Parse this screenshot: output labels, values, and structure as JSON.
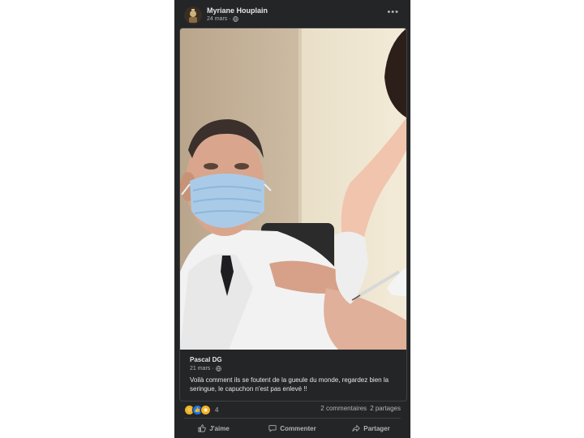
{
  "post": {
    "author": "Myriane Houplain",
    "date": "24 mars",
    "audience_icon": "globe-icon",
    "more_icon": "ellipsis-icon",
    "more_label": "•••"
  },
  "shared_post": {
    "author": "Pascal DG",
    "date": "21 mars",
    "audience_icon": "globe-icon",
    "text": "Voilà comment ils se foutent de la gueule du monde, regardez bien la seringue, le capuchon n'est pas enlevé !!"
  },
  "stats": {
    "reaction_icons": [
      "haha-icon",
      "like-icon",
      "wow-icon"
    ],
    "reaction_count": "4",
    "comments": "2 commentaires",
    "shares": "2 partages"
  },
  "actions": {
    "like": "J'aime",
    "comment": "Commenter",
    "share": "Partager"
  },
  "colors": {
    "card_bg": "#242526",
    "text_primary": "#e4e6eb",
    "text_secondary": "#b0b3b8",
    "divider": "#3e4042"
  }
}
